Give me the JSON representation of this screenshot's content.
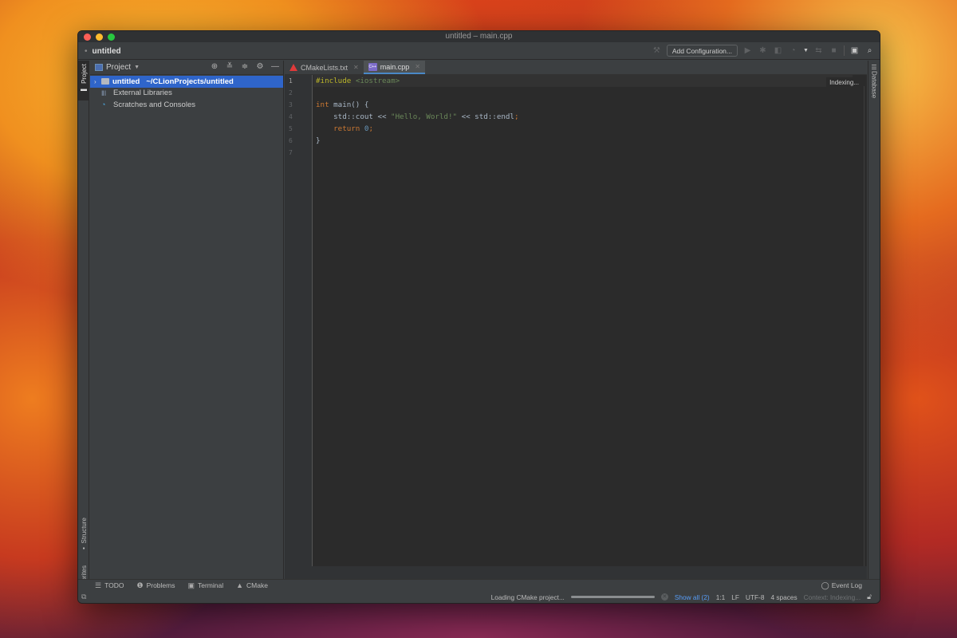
{
  "window": {
    "title": "untitled – main.cpp"
  },
  "navbar": {
    "project_name": "untitled",
    "add_configuration_label": "Add Configuration...",
    "icons": [
      "hammer-icon",
      "run-icon",
      "debug-icon",
      "coverage-icon",
      "profile-icon",
      "dropdown-icon",
      "attach-icon",
      "stop-icon",
      "terminal-icon",
      "search-icon"
    ]
  },
  "left_strip": {
    "project_label": "Project",
    "structure_label": "Structure",
    "favorites_label": "Favorites"
  },
  "right_strip": {
    "database_label": "Database"
  },
  "project_panel": {
    "title": "Project",
    "tree": [
      {
        "name": "untitled",
        "path": "~/CLionProjects/untitled",
        "selected": true,
        "icon": "folder-icon"
      },
      {
        "name": "External Libraries",
        "icon": "library-icon"
      },
      {
        "name": "Scratches and Consoles",
        "icon": "scratch-icon"
      }
    ]
  },
  "editor": {
    "tabs": [
      {
        "label": "CMakeLists.txt",
        "icon": "cmake-icon",
        "active": false
      },
      {
        "label": "main.cpp",
        "icon": "cpp-file-icon",
        "active": true
      }
    ],
    "indexing_label": "Indexing...",
    "line_numbers": [
      "1",
      "2",
      "3",
      "4",
      "5",
      "6",
      "7"
    ],
    "code": {
      "l1_directive": "#include",
      "l1_header": "<iostream>",
      "l3_type": "int",
      "l3_rest": " main() {",
      "l4_a": "    std::cout << ",
      "l4_str": "\"Hello, World!\"",
      "l4_b": " << std::endl",
      "l4_semi": ";",
      "l5_indent": "    ",
      "l5_kw": "return",
      "l5_num": "0",
      "l5_semi": ";",
      "l6": "}"
    }
  },
  "tool_windows": {
    "todo": "TODO",
    "problems": "Problems",
    "terminal": "Terminal",
    "cmake": "CMake",
    "event_log": "Event Log"
  },
  "statusbar": {
    "progress_text": "Loading CMake project...",
    "show_all": "Show all (2)",
    "position": "1:1",
    "line_sep": "LF",
    "encoding": "UTF-8",
    "indent": "4 spaces",
    "context": "Context: Indexing..."
  }
}
